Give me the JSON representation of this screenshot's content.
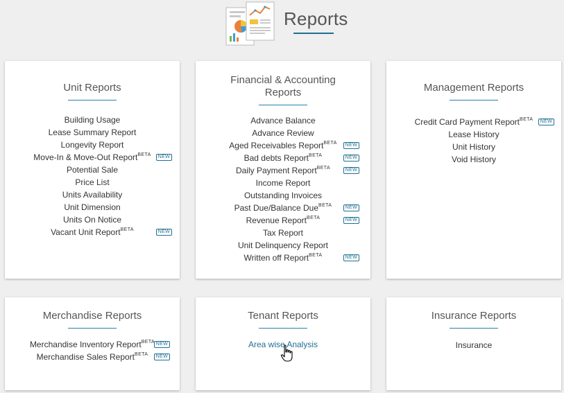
{
  "page": {
    "title": "Reports"
  },
  "badge_text": "NEW",
  "beta_text": "BETA",
  "colors": {
    "accent": "#1f6f92",
    "background": "#efefef",
    "card": "#ffffff"
  },
  "cards": {
    "unit": {
      "title": "Unit Reports",
      "items": [
        {
          "label": "Building Usage"
        },
        {
          "label": "Lease Summary Report"
        },
        {
          "label": "Longevity Report"
        },
        {
          "label": "Move-In & Move-Out Report",
          "beta": true,
          "new": true
        },
        {
          "label": "Potential Sale"
        },
        {
          "label": "Price List"
        },
        {
          "label": "Units Availability"
        },
        {
          "label": "Unit Dimension"
        },
        {
          "label": "Units On Notice"
        },
        {
          "label": "Vacant Unit Report",
          "beta": true,
          "new": true
        }
      ]
    },
    "financial": {
      "title_line1": "Financial & Accounting",
      "title_line2": "Reports",
      "items": [
        {
          "label": "Advance Balance"
        },
        {
          "label": "Advance Review"
        },
        {
          "label": "Aged Receivables Report",
          "beta": true,
          "new": true
        },
        {
          "label": "Bad debts Report",
          "beta": true,
          "new": true
        },
        {
          "label": "Daily Payment Report",
          "beta": true,
          "new": true
        },
        {
          "label": "Income Report"
        },
        {
          "label": "Outstanding Invoices"
        },
        {
          "label": "Past Due/Balance Due",
          "beta": true,
          "new": true
        },
        {
          "label": "Revenue Report",
          "beta": true,
          "new": true
        },
        {
          "label": "Tax Report"
        },
        {
          "label": "Unit Delinquency Report"
        },
        {
          "label": "Written off Report",
          "beta": true,
          "new": true
        }
      ]
    },
    "management": {
      "title": "Management Reports",
      "items": [
        {
          "label": "Credit Card Payment Report",
          "beta": true,
          "new": true
        },
        {
          "label": "Lease History"
        },
        {
          "label": "Unit History"
        },
        {
          "label": "Void History"
        }
      ]
    },
    "merchandise": {
      "title": "Merchandise Reports",
      "items": [
        {
          "label": "Merchandise Inventory Report",
          "beta": true,
          "new": true
        },
        {
          "label": "Merchandise Sales Report",
          "beta": true,
          "new": true
        }
      ]
    },
    "tenant": {
      "title": "Tenant Reports",
      "items": [
        {
          "label": "Area wise Analysis",
          "hovered": true
        }
      ]
    },
    "insurance": {
      "title": "Insurance Reports",
      "items": [
        {
          "label": "Insurance"
        }
      ]
    }
  }
}
